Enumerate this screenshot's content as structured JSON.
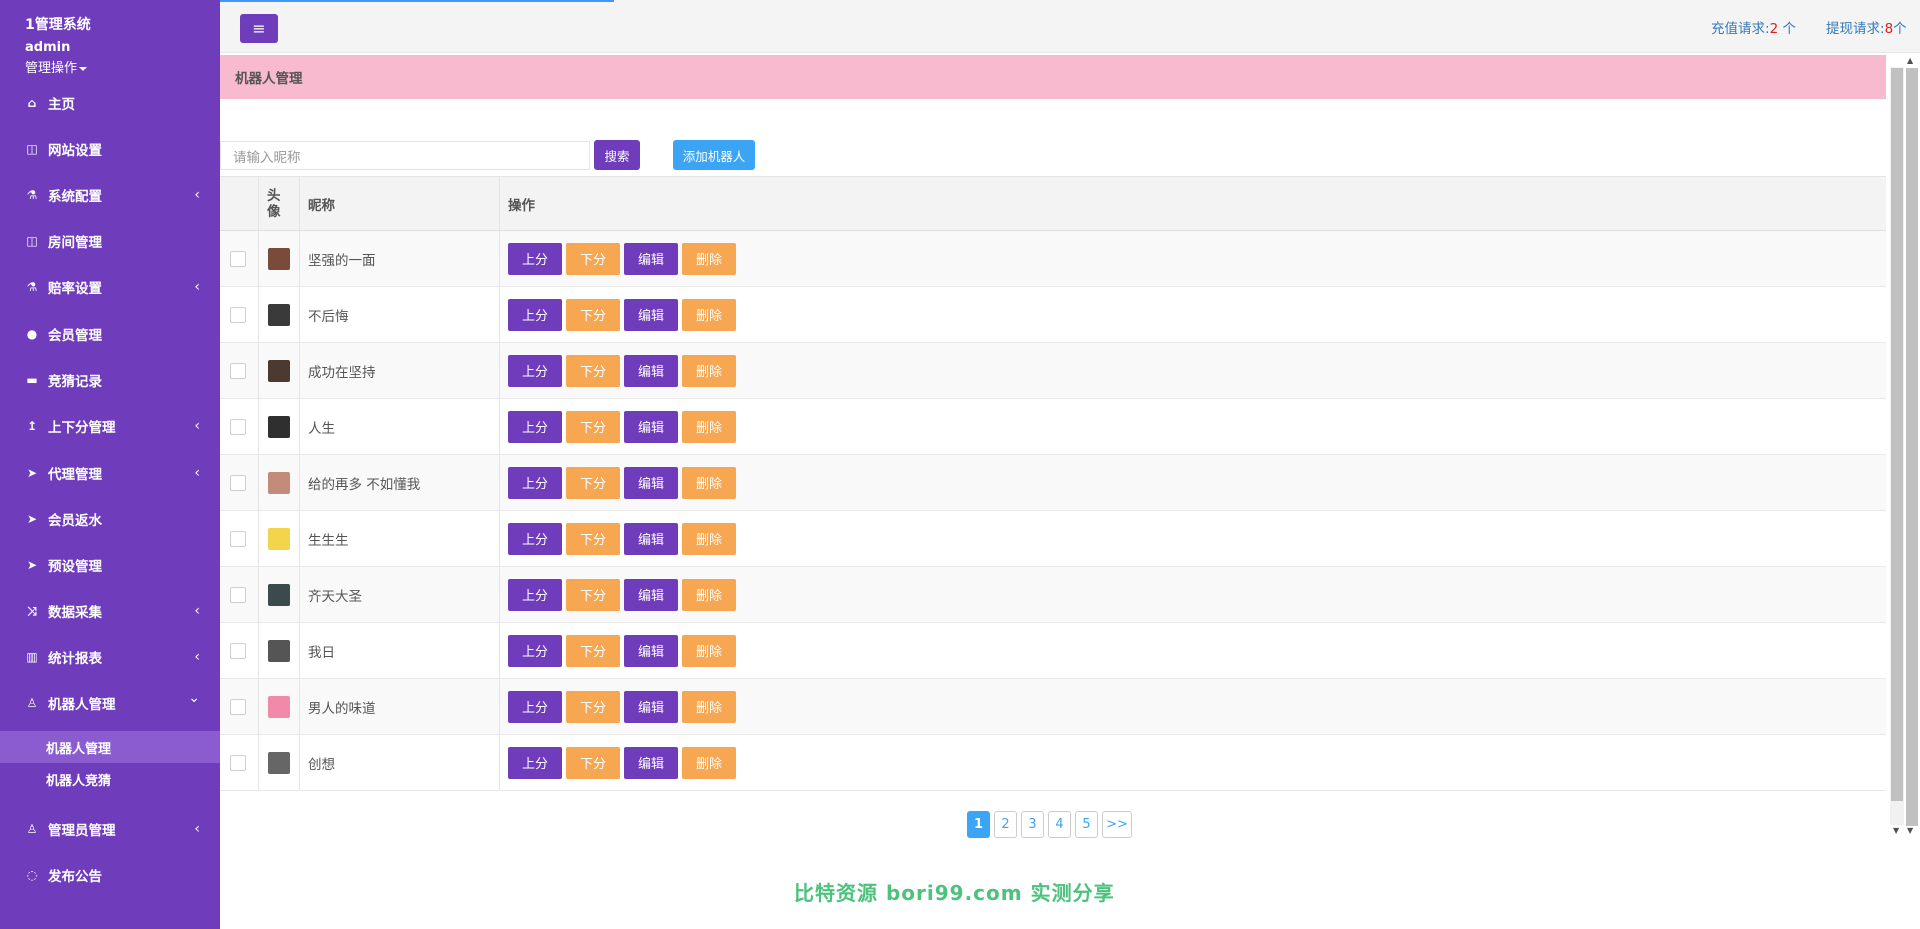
{
  "sidebar": {
    "brand": "1管理系统",
    "user": "admin",
    "user_menu": "管理操作",
    "items": [
      {
        "label": "主页",
        "icon": "home-icon",
        "glyph": "⌂"
      },
      {
        "label": "网站设置",
        "icon": "columns-icon",
        "glyph": "◫"
      },
      {
        "label": "系统配置",
        "icon": "flask-icon",
        "glyph": "⚗"
      },
      {
        "label": "房间管理",
        "icon": "columns-icon",
        "glyph": "◫"
      },
      {
        "label": "赔率设置",
        "icon": "flask-icon",
        "glyph": "⚗"
      },
      {
        "label": "会员管理",
        "icon": "user-icon",
        "glyph": "●"
      },
      {
        "label": "竞猜记录",
        "icon": "car-icon",
        "glyph": "▬"
      },
      {
        "label": "上下分管理",
        "icon": "level-up-icon",
        "glyph": "↥"
      },
      {
        "label": "代理管理",
        "icon": "paper-plane-icon",
        "glyph": "➤"
      },
      {
        "label": "会员返水",
        "icon": "paper-plane-icon",
        "glyph": "➤"
      },
      {
        "label": "预设管理",
        "icon": "paper-plane-icon",
        "glyph": "➤"
      },
      {
        "label": "数据采集",
        "icon": "random-icon",
        "glyph": "⤨"
      },
      {
        "label": "统计报表",
        "icon": "bar-chart-icon",
        "glyph": "▥"
      },
      {
        "label": "机器人管理",
        "icon": "male-icon",
        "glyph": "♙"
      },
      {
        "label": "管理员管理",
        "icon": "male-icon",
        "glyph": "♙"
      },
      {
        "label": "发布公告",
        "icon": "comment-icon",
        "glyph": "◌"
      }
    ],
    "subitems": [
      {
        "label": "机器人管理"
      },
      {
        "label": "机器人竞猜"
      }
    ],
    "chevron_left": "‹",
    "chevron_down": "⌄"
  },
  "topbar": {
    "menu_glyph": "≡",
    "recharge_label": "充值请求:",
    "recharge_count": "2",
    "recharge_unit": " 个",
    "withdraw_label": "提现请求:",
    "withdraw_count": "8",
    "withdraw_unit": "个"
  },
  "page": {
    "title": "机器人管理",
    "search_placeholder": "请输入昵称",
    "search_button": "搜索",
    "add_button": "添加机器人"
  },
  "table": {
    "headers": {
      "avatar": "头像",
      "nickname": "昵称",
      "actions": "操作"
    },
    "action_labels": {
      "up": "上分",
      "down": "下分",
      "edit": "编辑",
      "delete": "删除"
    },
    "rows": [
      {
        "nickname": "坚强的一面",
        "avatar_color": "#7a4a3a"
      },
      {
        "nickname": "不后悔",
        "avatar_color": "#3a3a3a"
      },
      {
        "nickname": "成功在坚持",
        "avatar_color": "#4a3a30"
      },
      {
        "nickname": "人生",
        "avatar_color": "#2f2f2f"
      },
      {
        "nickname": "给的再多 不如懂我",
        "avatar_color": "#c28b7a"
      },
      {
        "nickname": "生生生",
        "avatar_color": "#f3d44a"
      },
      {
        "nickname": "齐天大圣",
        "avatar_color": "#3b4a4a"
      },
      {
        "nickname": "我日",
        "avatar_color": "#555555"
      },
      {
        "nickname": "男人的味道",
        "avatar_color": "#f08aa8"
      },
      {
        "nickname": "创想",
        "avatar_color": "#666666"
      }
    ]
  },
  "pagination": {
    "pages": [
      "1",
      "2",
      "3",
      "4",
      "5"
    ],
    "next": ">>",
    "current": "1"
  },
  "watermark": "比特资源 bori99.com 实测分享",
  "colors": {
    "sidebar": "#6f3cbc",
    "header_pink": "#f7bace",
    "orange": "#f7a751",
    "blue": "#3ba4f5"
  }
}
